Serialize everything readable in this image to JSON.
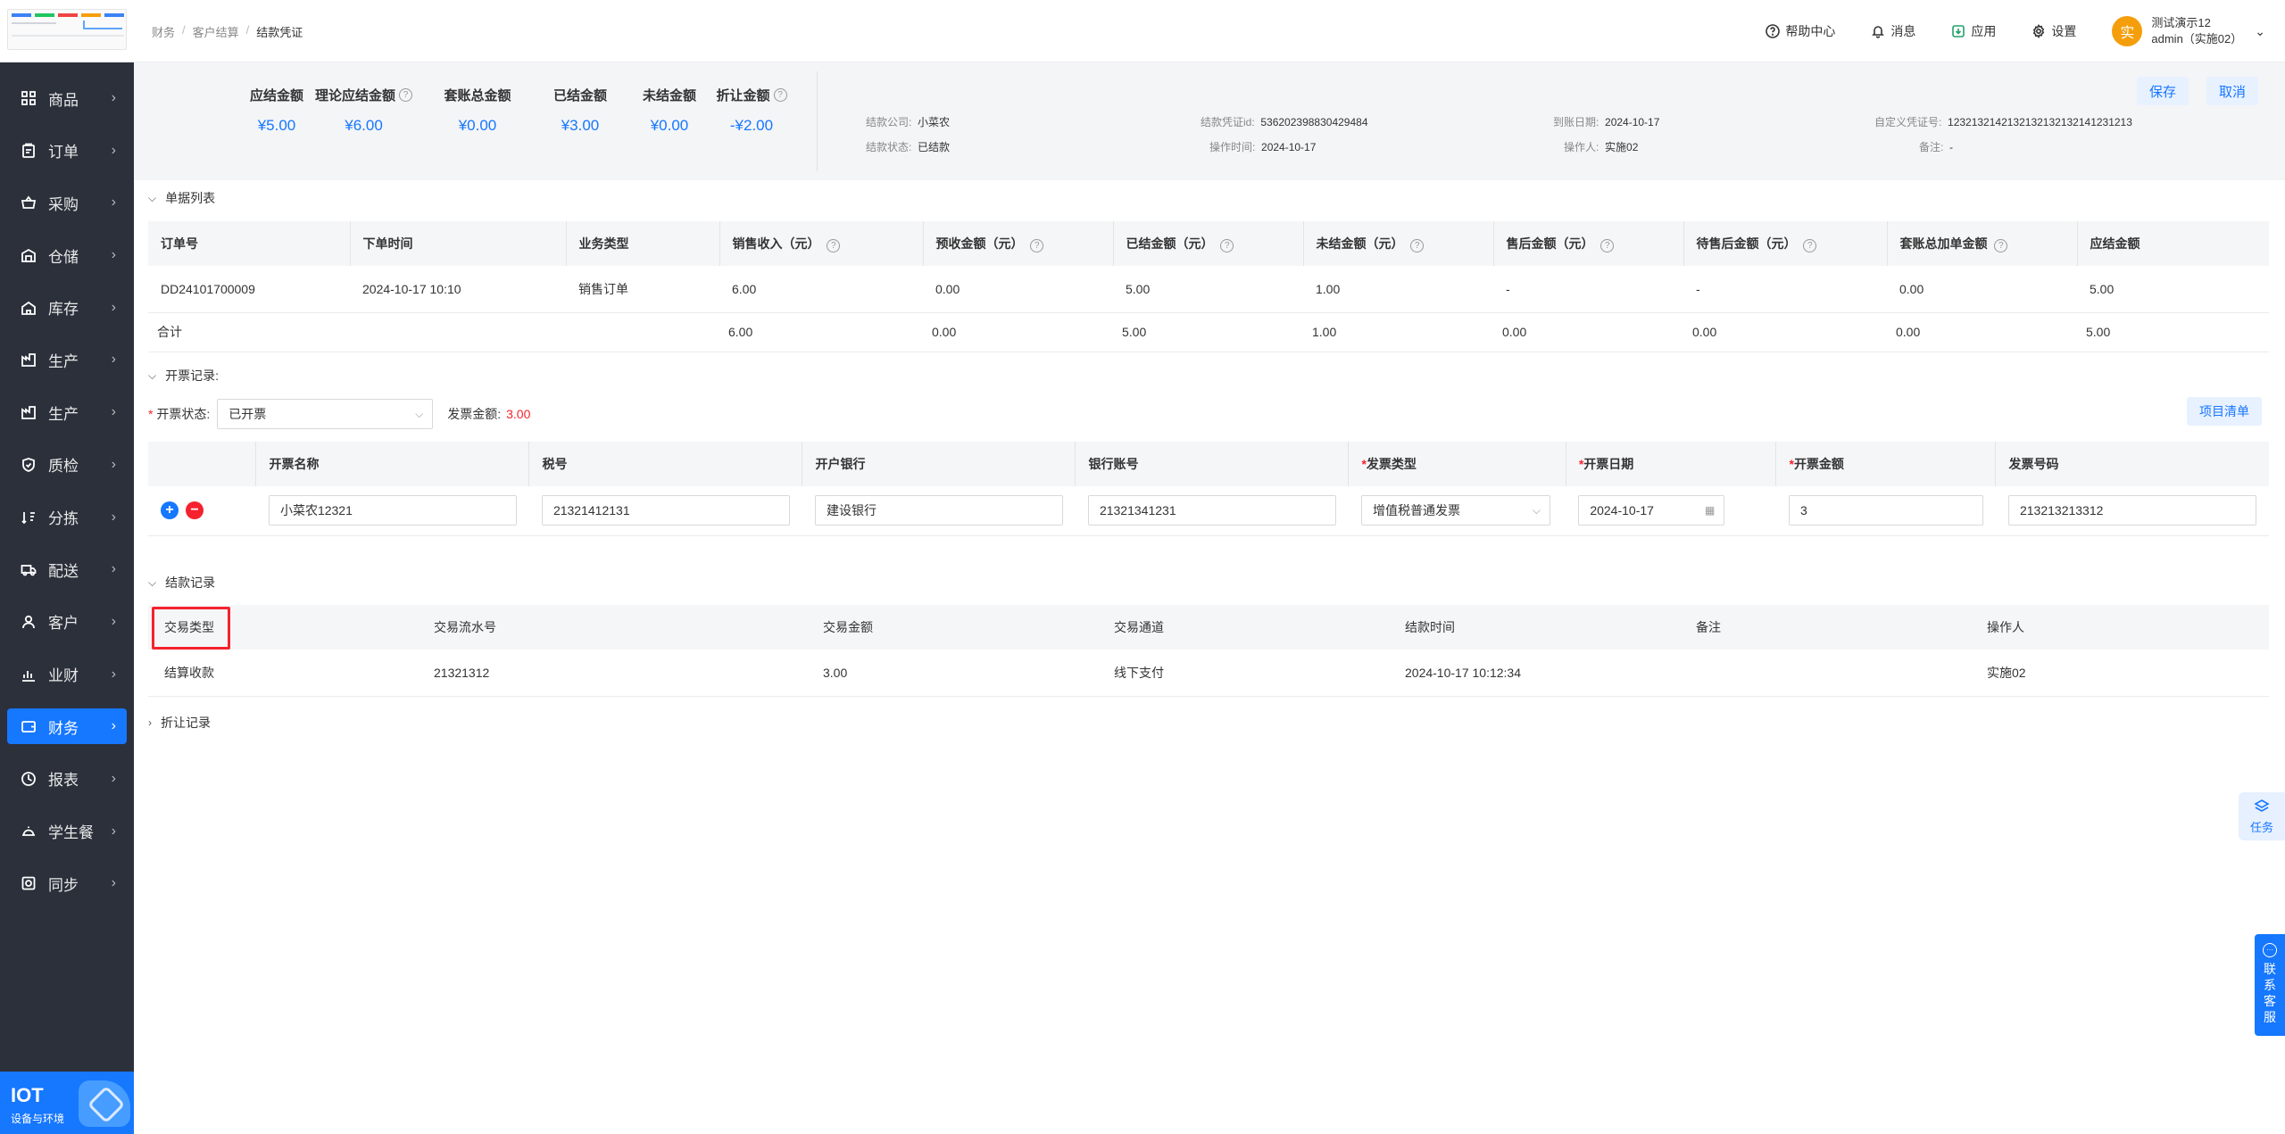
{
  "sidebar": {
    "items": [
      {
        "label": "商品",
        "icon": "grid-icon"
      },
      {
        "label": "订单",
        "icon": "clipboard-icon"
      },
      {
        "label": "采购",
        "icon": "basket-icon"
      },
      {
        "label": "仓储",
        "icon": "warehouse-icon"
      },
      {
        "label": "库存",
        "icon": "home-icon"
      },
      {
        "label": "生产",
        "icon": "factory-icon"
      },
      {
        "label": "生产",
        "icon": "factory-icon"
      },
      {
        "label": "质检",
        "icon": "shield-icon"
      },
      {
        "label": "分拣",
        "icon": "sort-icon"
      },
      {
        "label": "配送",
        "icon": "truck-icon"
      },
      {
        "label": "客户",
        "icon": "user-icon"
      },
      {
        "label": "业财",
        "icon": "chart-icon"
      },
      {
        "label": "财务",
        "icon": "wallet-icon",
        "active": true
      },
      {
        "label": "报表",
        "icon": "report-icon"
      },
      {
        "label": "学生餐",
        "icon": "meal-icon"
      },
      {
        "label": "同步",
        "icon": "sync-icon"
      }
    ],
    "bottom": {
      "title": "IOT",
      "subtitle": "设备与环境"
    }
  },
  "header": {
    "breadcrumb": [
      "财务",
      "客户结算",
      "结款凭证"
    ],
    "help": "帮助中心",
    "messages": "消息",
    "apps": "应用",
    "settings": "设置",
    "avatar_char": "实",
    "user_name": "测试演示12",
    "user_account": "admin（实施02）"
  },
  "summary": {
    "stats": [
      {
        "label": "应结金额",
        "value": "¥5.00",
        "help": false
      },
      {
        "label": "理论应结金额",
        "value": "¥6.00",
        "help": true
      },
      {
        "label": "套账总金额",
        "value": "¥0.00",
        "help": false
      },
      {
        "label": "已结金额",
        "value": "¥3.00",
        "help": false
      },
      {
        "label": "未结金额",
        "value": "¥0.00",
        "help": false
      },
      {
        "label": "折让金额",
        "value": "-¥2.00",
        "help": true
      }
    ],
    "info": {
      "company_k": "结款公司:",
      "company_v": "小菜农",
      "status_k": "结款状态:",
      "status_v": "已结款",
      "voucher_k": "结款凭证id:",
      "voucher_v": "536202398830429484",
      "optime_k": "操作时间:",
      "optime_v": "2024-10-17",
      "arrive_k": "到账日期:",
      "arrive_v": "2024-10-17",
      "operator_k": "操作人:",
      "operator_v": "实施02",
      "custom_k": "自定义凭证号:",
      "custom_v": "1232132142132132132132141231213",
      "remark_k": "备注:",
      "remark_v": "-"
    },
    "save": "保存",
    "cancel": "取消"
  },
  "doc_list": {
    "title": "单据列表",
    "headers": [
      "订单号",
      "下单时间",
      "业务类型",
      "销售收入（元）",
      "预收金额（元）",
      "已结金额（元）",
      "未结金额（元）",
      "售后金额（元）",
      "待售后金额（元）",
      "套账总加单金额",
      "应结金额"
    ],
    "help_cols": [
      false,
      false,
      false,
      true,
      true,
      true,
      true,
      true,
      true,
      true,
      false
    ],
    "row": [
      "DD24101700009",
      "2024-10-17 10:10",
      "销售订单",
      "6.00",
      "0.00",
      "5.00",
      "1.00",
      "-",
      "-",
      "0.00",
      "5.00"
    ],
    "total": [
      "合计",
      "",
      "",
      "6.00",
      "0.00",
      "5.00",
      "1.00",
      "0.00",
      "0.00",
      "0.00",
      "5.00"
    ]
  },
  "invoice": {
    "title": "开票记录:",
    "status_label": "开票状态:",
    "status_value": "已开票",
    "amount_label": "发票金额:",
    "amount_value": "3.00",
    "item_list_btn": "项目清单",
    "headers": [
      "开票名称",
      "税号",
      "开户银行",
      "银行账号",
      "发票类型",
      "开票日期",
      "开票金额",
      "发票号码"
    ],
    "required": [
      false,
      false,
      false,
      false,
      true,
      true,
      true,
      false
    ],
    "values": [
      "小菜农12321",
      "21321412131",
      "建设银行",
      "21321341231",
      "增值税普通发票",
      "2024-10-17",
      "3",
      "213213213312"
    ]
  },
  "settlement": {
    "title": "结款记录",
    "headers": [
      "交易类型",
      "交易流水号",
      "交易金额",
      "交易通道",
      "结款时间",
      "备注",
      "操作人"
    ],
    "row": [
      "结算收款",
      "21321312",
      "3.00",
      "线下支付",
      "2024-10-17 10:12:34",
      "",
      "实施02"
    ]
  },
  "discount": {
    "title": "折让记录"
  },
  "float": {
    "task": "任务",
    "cs": "联系客服"
  },
  "colors": {
    "primary": "#1677ff",
    "danger": "#f5222d",
    "sidebar": "#2b303b"
  }
}
